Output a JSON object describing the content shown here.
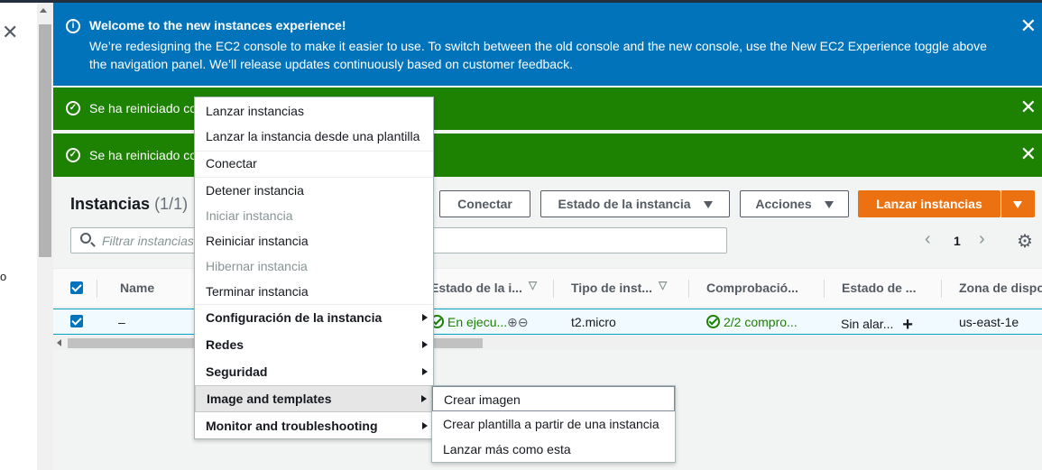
{
  "left_panel": {
    "close_glyph": "✕",
    "fragment": "o"
  },
  "flash": {
    "info": {
      "icon": "info-icon",
      "title": "Welcome to the new instances experience!",
      "body": "We’re redesigning the EC2 console to make it easier to use. To switch between the old console and the new console, use the New EC2 Experience toggle above the navigation panel. We’ll release updates continuously based on customer feedback.",
      "color": "#0073bb"
    },
    "success_1": {
      "icon": "check-circle-icon",
      "text": "Se ha reiniciado co",
      "color": "#1d8102"
    },
    "success_2": {
      "icon": "check-circle-icon",
      "text": "Se ha reiniciado co",
      "color": "#1d8102"
    },
    "close_glyph": "✕"
  },
  "header": {
    "title": "Instancias",
    "count": "(1/1)",
    "buttons": {
      "connect": "Conectar",
      "instance_state": "Estado de la instancia",
      "actions": "Acciones",
      "launch": "Lanzar instancias"
    },
    "search_placeholder": "Filtrar instancias",
    "pagination": {
      "prev": "‹",
      "page": "1",
      "next": "›"
    },
    "settings_glyph": "⚙",
    "accent": "#ec7211"
  },
  "table": {
    "columns": [
      "Name",
      "Estado de la i...",
      "Tipo de inst...",
      "Comprobació...",
      "Estado de ...",
      "Zona de dispo"
    ],
    "row": {
      "name": "–",
      "state": "En ejecu...",
      "zoom_in": "⊕",
      "zoom_out": "⊖",
      "type": "t2.micro",
      "checks": "2/2 compro...",
      "alarm": "Sin alar...",
      "add_glyph": "+",
      "zone": "us-east-1e"
    }
  },
  "context_menu": {
    "items": [
      "Lanzar instancias",
      "Lanzar la instancia desde una plantilla",
      "Conectar",
      "Detener instancia",
      "Iniciar instancia",
      "Reiniciar instancia",
      "Hibernar instancia",
      "Terminar instancia",
      "Configuración de la instancia",
      "Redes",
      "Seguridad",
      "Image and templates",
      "Monitor and troubleshooting"
    ],
    "submenu": [
      "Crear imagen",
      "Crear plantilla a partir de una instancia",
      "Lanzar más como esta"
    ]
  }
}
